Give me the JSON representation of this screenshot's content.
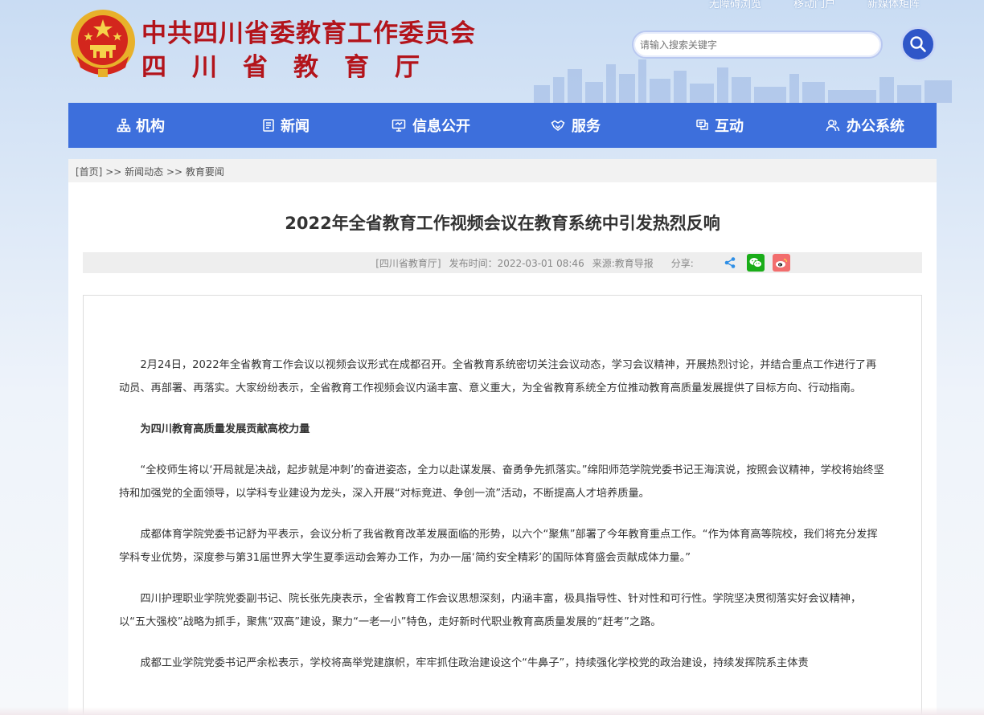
{
  "header": {
    "title_main": "中共四川省委教育工作委员会",
    "title_sub": "四川省教育厅",
    "top_links": [
      "无障碍浏览",
      "移动门户",
      "新媒体矩阵"
    ],
    "search_placeholder": "请输入搜索关键字"
  },
  "nav": {
    "items": [
      {
        "label": "机构",
        "icon": "org-chart-icon"
      },
      {
        "label": "新闻",
        "icon": "newspaper-icon"
      },
      {
        "label": "信息公开",
        "icon": "monitor-icon"
      },
      {
        "label": "服务",
        "icon": "handshake-icon"
      },
      {
        "label": "互动",
        "icon": "chat-icon"
      },
      {
        "label": "办公系统",
        "icon": "users-icon"
      }
    ]
  },
  "breadcrumb": {
    "home": "[首页]",
    "sep1": ">>",
    "level1": "新闻动态",
    "sep2": ">>",
    "level2": "教育要闻"
  },
  "article": {
    "title": "2022年全省教育工作视频会议在教育系统中引发热烈反响",
    "meta": {
      "org": "[四川省教育厅]",
      "publish": "发布时间：2022-03-01 08:46",
      "source": "来源:教育导报",
      "share_label": "分享:"
    },
    "paragraphs": [
      "2月24日，2022年全省教育工作会议以视频会议形式在成都召开。全省教育系统密切关注会议动态，学习会议精神，开展热烈讨论，并结合重点工作进行了再动员、再部署、再落实。大家纷纷表示，全省教育工作视频会议内涵丰富、意义重大，为全省教育系统全方位推动教育高质量发展提供了目标方向、行动指南。",
      "为四川教育高质量发展贡献高校力量",
      "“全校师生将以‘开局就是决战，起步就是冲刺’的奋进姿态，全力以赴谋发展、奋勇争先抓落实。”绵阳师范学院党委书记王海滨说，按照会议精神，学校将始终坚持和加强党的全面领导，以学科专业建设为龙头，深入开展“对标竞进、争创一流”活动，不断提高人才培养质量。",
      "成都体育学院党委书记舒为平表示，会议分析了我省教育改革发展面临的形势，以六个“聚焦”部署了今年教育重点工作。“作为体育高等院校，我们将充分发挥学科专业优势，深度参与第31届世界大学生夏季运动会筹办工作，为办一届‘简约安全精彩’的国际体育盛会贡献成体力量。”",
      "四川护理职业学院党委副书记、院长张先庚表示，全省教育工作会议思想深刻，内涵丰富，极具指导性、针对性和可行性。学院坚决贯彻落实好会议精神，以“五大强校”战略为抓手，聚焦“双高”建设，聚力“一老一小”特色，走好新时代职业教育高质量发展的“赶考”之路。",
      "成都工业学院党委书记严余松表示，学校将高举党建旗帜，牢牢抓住政治建设这个“牛鼻子”，持续强化学校党的政治建设，持续发挥院系主体责"
    ]
  },
  "colors": {
    "brand_red": "#b3141b",
    "nav_blue": "#3d6fdc",
    "search_blue": "#2f56c8",
    "wechat_green": "#1aad19",
    "weibo_red": "#f26d6d"
  }
}
